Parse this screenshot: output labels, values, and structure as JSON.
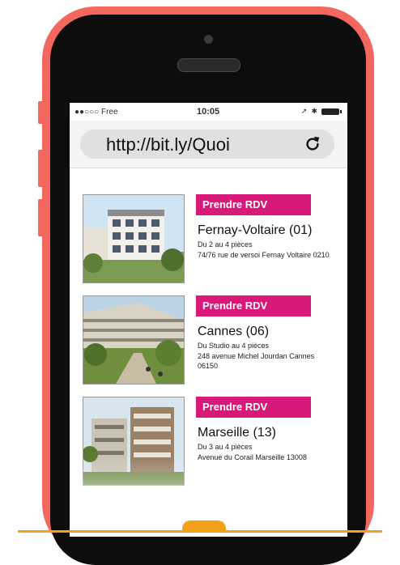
{
  "status_bar": {
    "carrier": "●●○○○ Free",
    "time": "10:05"
  },
  "browser": {
    "url": "http://bit.ly/Quoi"
  },
  "listings": [
    {
      "button_label": "Prendre RDV",
      "city": "Fernay-Voltaire (01)",
      "rooms": "Du 2 au 4 pièces",
      "address": "74/76 rue de versoi Fernay Voltaire 0210"
    },
    {
      "button_label": "Prendre RDV",
      "city": "Cannes (06)",
      "rooms": "Du Studio au 4 pièces",
      "address": "248 avenue Michel Jourdan Cannes 06150"
    },
    {
      "button_label": "Prendre RDV",
      "city": "Marseille (13)",
      "rooms": "Du 3 au 4 pièces",
      "address": "Avenue du Corail Marseille 13008"
    }
  ],
  "colors": {
    "phone_case": "#f2675e",
    "button": "#d8197a",
    "accent_line": "#f2a11b"
  }
}
